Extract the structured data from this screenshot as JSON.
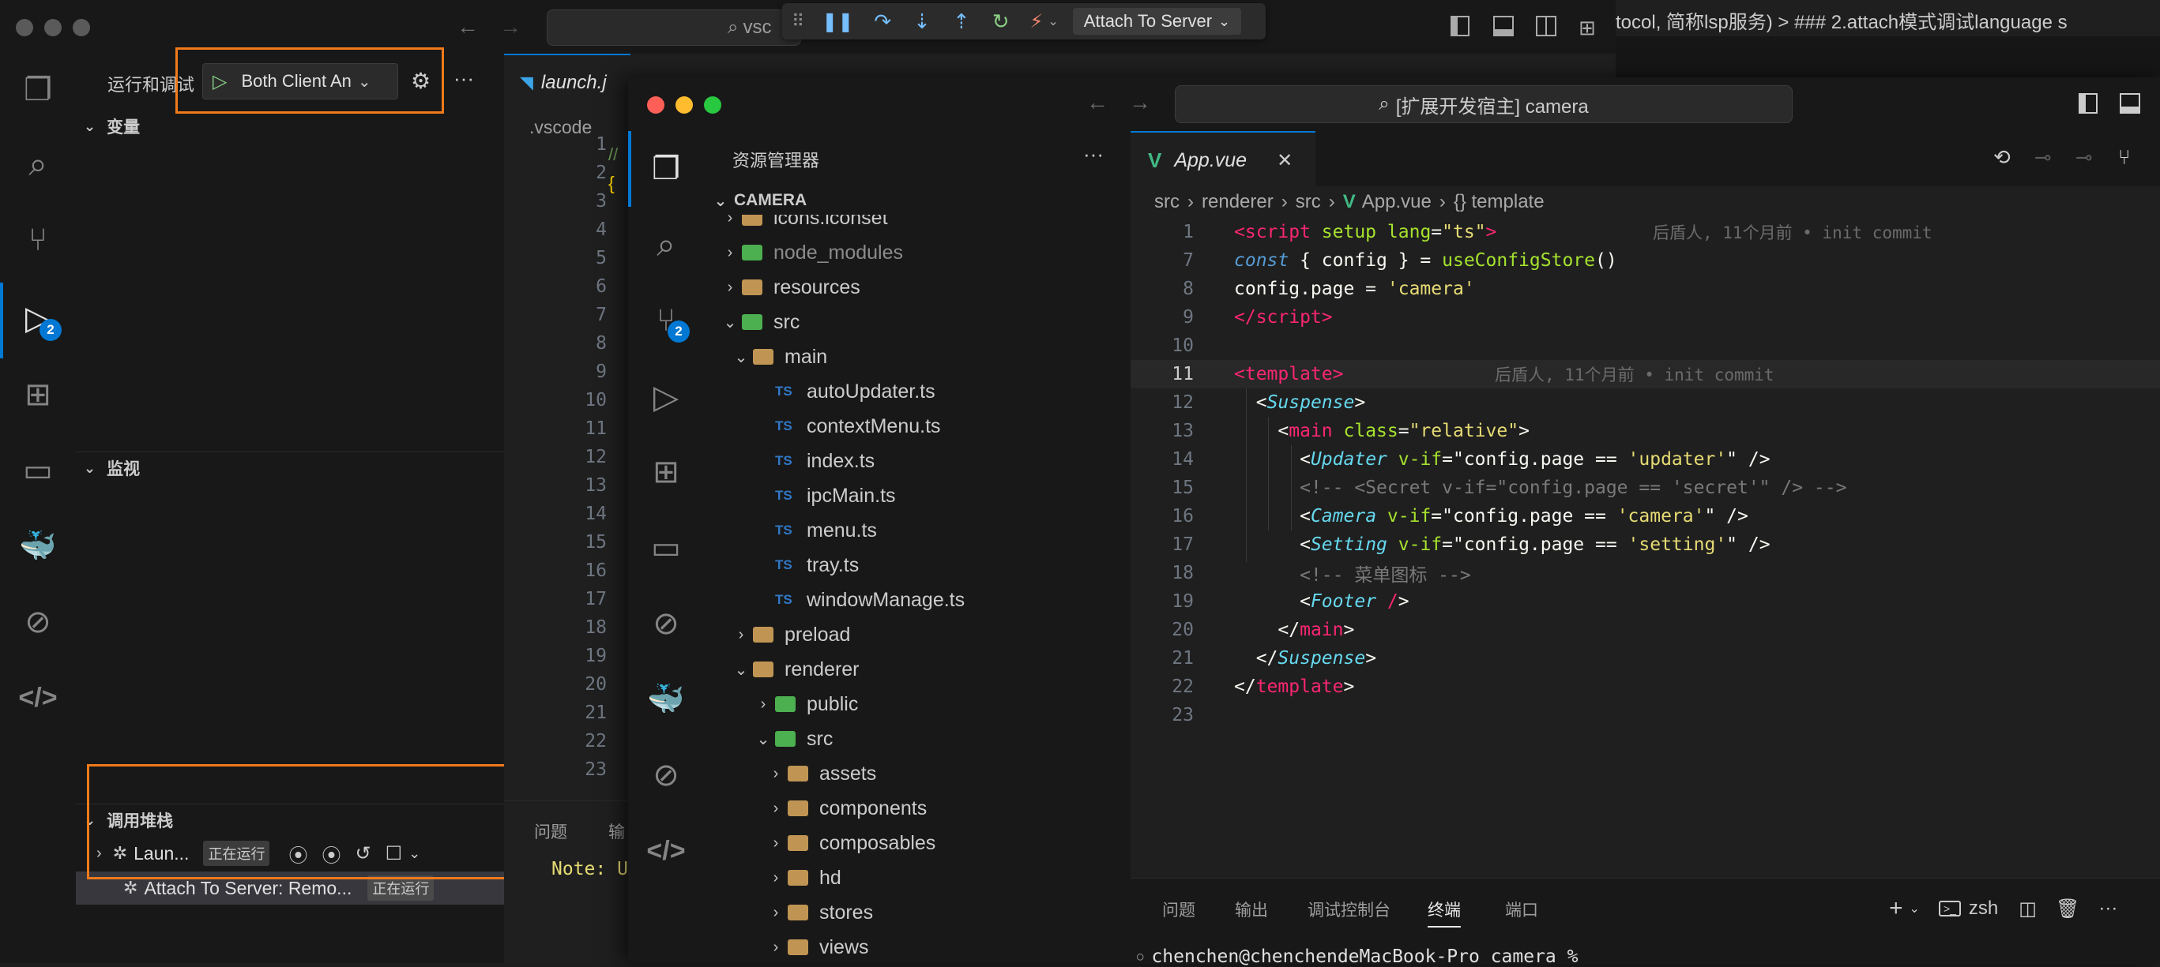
{
  "back": {
    "run_debug_title": "运行和调试",
    "launch_config": "Both Client An",
    "variables_title": "变量",
    "watch_title": "监视",
    "callstack_title": "调用堆栈",
    "callstack_items": [
      {
        "label": "Laun...",
        "status": "正在运行"
      },
      {
        "label": "Attach To Server: Remo...",
        "status": "正在运行"
      }
    ],
    "debug_toolbar_config": "Attach To Server",
    "search_partial": "vsc",
    "tab_label": "launch.j",
    "breadcrumb": ".vscode",
    "line_numbers": [
      "1",
      "2",
      "3",
      "4",
      "5",
      "6",
      "7",
      "8",
      "9",
      "10",
      "11",
      "12",
      "13",
      "14",
      "15",
      "16",
      "17",
      "18",
      "19",
      "20",
      "21",
      "22",
      "23"
    ],
    "activity_badge": "2",
    "panel_tab_problems": "问题",
    "panel_tab_output_partial": "输",
    "panel_note": "Note: U",
    "top_right_text": "tocol, 简称lsp服务) > ### 2.attach模式调试language s"
  },
  "front": {
    "search_title": "[扩展开发宿主] camera",
    "explorer_title": "资源管理器",
    "root_folder": "CAMERA",
    "tree": [
      {
        "label": "icons.iconset",
        "indent": 0,
        "type": "folder",
        "open": false
      },
      {
        "label": "node_modules",
        "indent": 0,
        "type": "folder-special",
        "open": false
      },
      {
        "label": "resources",
        "indent": 0,
        "type": "folder",
        "open": false
      },
      {
        "label": "src",
        "indent": 0,
        "type": "folder-special",
        "open": true
      },
      {
        "label": "main",
        "indent": 1,
        "type": "folder",
        "open": true
      },
      {
        "label": "autoUpdater.ts",
        "indent": 2,
        "type": "ts"
      },
      {
        "label": "contextMenu.ts",
        "indent": 2,
        "type": "ts"
      },
      {
        "label": "index.ts",
        "indent": 2,
        "type": "ts"
      },
      {
        "label": "ipcMain.ts",
        "indent": 2,
        "type": "ts"
      },
      {
        "label": "menu.ts",
        "indent": 2,
        "type": "ts"
      },
      {
        "label": "tray.ts",
        "indent": 2,
        "type": "ts"
      },
      {
        "label": "windowManage.ts",
        "indent": 2,
        "type": "ts"
      },
      {
        "label": "preload",
        "indent": 1,
        "type": "folder",
        "open": false
      },
      {
        "label": "renderer",
        "indent": 1,
        "type": "folder",
        "open": true
      },
      {
        "label": "public",
        "indent": 2,
        "type": "folder-special",
        "open": false
      },
      {
        "label": "src",
        "indent": 2,
        "type": "folder-special",
        "open": true
      },
      {
        "label": "assets",
        "indent": 3,
        "type": "folder",
        "open": false
      },
      {
        "label": "components",
        "indent": 3,
        "type": "folder",
        "open": false
      },
      {
        "label": "composables",
        "indent": 3,
        "type": "folder",
        "open": false
      },
      {
        "label": "hd",
        "indent": 3,
        "type": "folder",
        "open": false
      },
      {
        "label": "stores",
        "indent": 3,
        "type": "folder",
        "open": false
      },
      {
        "label": "views",
        "indent": 3,
        "type": "folder",
        "open": false
      }
    ],
    "activity_badge": "2",
    "tab_label": "App.vue",
    "breadcrumb": [
      "src",
      "renderer",
      "src",
      "App.vue",
      "{} template"
    ],
    "code_lines": [
      {
        "n": "1",
        "blame": "后盾人, 11个月前 • init commit"
      },
      {
        "n": "7",
        "blame": ""
      },
      {
        "n": "8",
        "blame": ""
      },
      {
        "n": "9",
        "blame": ""
      },
      {
        "n": "10",
        "blame": ""
      },
      {
        "n": "11",
        "blame": "后盾人, 11个月前 • init commit"
      },
      {
        "n": "12",
        "blame": ""
      },
      {
        "n": "13",
        "blame": ""
      },
      {
        "n": "14",
        "blame": ""
      },
      {
        "n": "15",
        "blame": ""
      },
      {
        "n": "16",
        "blame": ""
      },
      {
        "n": "17",
        "blame": ""
      },
      {
        "n": "18",
        "blame": ""
      },
      {
        "n": "19",
        "blame": ""
      },
      {
        "n": "20",
        "blame": ""
      },
      {
        "n": "21",
        "blame": ""
      },
      {
        "n": "22",
        "blame": ""
      },
      {
        "n": "23",
        "blame": ""
      }
    ],
    "panel_tabs": [
      "问题",
      "输出",
      "调试控制台",
      "终端",
      "端口"
    ],
    "active_panel_tab": "终端",
    "terminal_shell": "zsh",
    "terminal_line": "chenchen@chenchendeMacBook-Pro camera %"
  },
  "colors": {
    "accent": "#0078d4",
    "highlight_box": "#f07a1a",
    "traffic_red": "#ff5f57",
    "traffic_yellow": "#febc2e",
    "traffic_green": "#28c840"
  }
}
